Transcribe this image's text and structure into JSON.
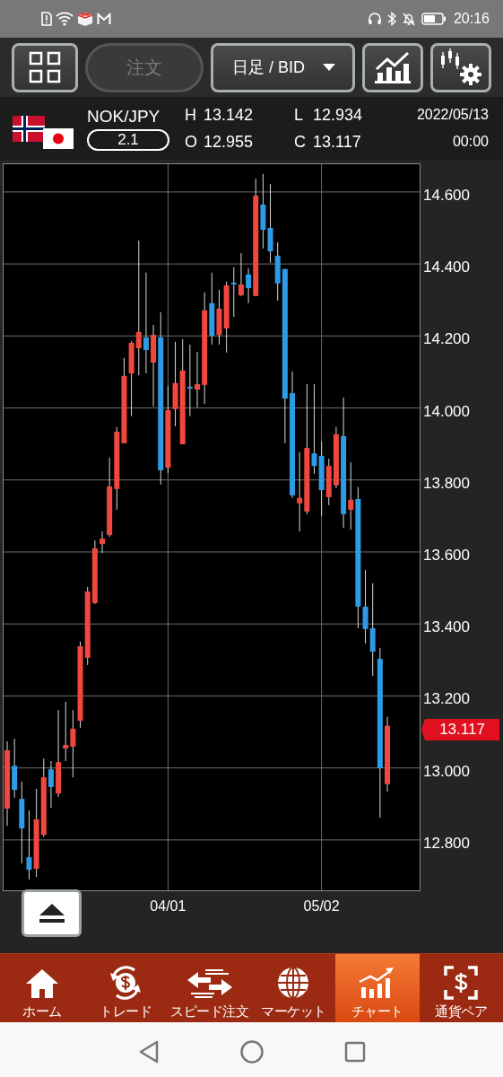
{
  "status_bar": {
    "time": "20:16"
  },
  "toolbar": {
    "order_button": {
      "label": "注文",
      "disabled": true
    },
    "timeframe_dropdown": {
      "label": "日足 / BID"
    }
  },
  "quote": {
    "pair": "NOK/JPY",
    "spread": "2.1",
    "high_label": "H",
    "high": "13.142",
    "low_label": "L",
    "low": "12.934",
    "open_label": "O",
    "open": "12.955",
    "close_label": "C",
    "close": "13.117",
    "date": "2022/05/13",
    "time": "00:00"
  },
  "chart": {
    "current_price": "13.117",
    "chart_data": {
      "type": "candlestick",
      "categories": [
        null,
        null,
        null,
        null,
        null,
        null,
        null,
        null,
        null,
        null,
        null,
        null,
        null,
        null,
        null,
        null,
        null,
        null,
        null,
        null,
        null,
        null,
        "04/01",
        null,
        null,
        null,
        null,
        null,
        null,
        null,
        null,
        null,
        null,
        null,
        null,
        null,
        null,
        null,
        null,
        null,
        null,
        null,
        null,
        "05/02",
        null,
        null,
        null,
        null,
        null,
        null,
        null,
        null,
        null
      ],
      "ohlc": [
        [
          12.887,
          13.074,
          12.839,
          13.049
        ],
        [
          13.006,
          13.081,
          12.917,
          12.939
        ],
        [
          12.914,
          12.962,
          12.735,
          12.832
        ],
        [
          12.752,
          12.882,
          12.69,
          12.717
        ],
        [
          12.72,
          12.942,
          12.697,
          12.857
        ],
        [
          12.814,
          13.026,
          12.809,
          12.974
        ],
        [
          12.996,
          13.019,
          12.889,
          12.947
        ],
        [
          12.929,
          13.161,
          12.919,
          13.016
        ],
        [
          13.054,
          13.184,
          13.019,
          13.064
        ],
        [
          13.059,
          13.161,
          12.974,
          13.109
        ],
        [
          13.131,
          13.351,
          13.111,
          13.338
        ],
        [
          13.306,
          13.503,
          13.286,
          13.49
        ],
        [
          13.458,
          13.632,
          13.455,
          13.61
        ],
        [
          13.622,
          13.657,
          13.597,
          13.637
        ],
        [
          13.647,
          13.862,
          13.642,
          13.782
        ],
        [
          13.775,
          13.947,
          13.717,
          13.934
        ],
        [
          13.902,
          14.139,
          13.902,
          14.089
        ],
        [
          14.096,
          14.186,
          13.977,
          14.181
        ],
        [
          14.166,
          14.465,
          14.091,
          14.211
        ],
        [
          14.196,
          14.376,
          14.096,
          14.161
        ],
        [
          14.126,
          14.231,
          14.004,
          14.203
        ],
        [
          14.196,
          14.266,
          13.787,
          13.827
        ],
        [
          13.834,
          14.061,
          13.819,
          13.994
        ],
        [
          13.997,
          14.184,
          13.949,
          14.069
        ],
        [
          13.899,
          14.191,
          13.899,
          14.104
        ],
        [
          14.059,
          14.176,
          13.977,
          14.054
        ],
        [
          14.051,
          14.156,
          14.001,
          14.066
        ],
        [
          14.064,
          14.321,
          14.011,
          14.271
        ],
        [
          14.291,
          14.376,
          14.176,
          14.201
        ],
        [
          14.203,
          14.328,
          14.176,
          14.276
        ],
        [
          14.221,
          14.351,
          14.154,
          14.341
        ],
        [
          14.348,
          14.391,
          14.253,
          14.343
        ],
        [
          14.313,
          14.43,
          14.311,
          14.343
        ],
        [
          14.371,
          14.388,
          14.291,
          14.333
        ],
        [
          14.311,
          14.637,
          14.311,
          14.59
        ],
        [
          14.565,
          14.65,
          14.443,
          14.495
        ],
        [
          14.5,
          14.622,
          14.403,
          14.435
        ],
        [
          14.423,
          14.46,
          14.298,
          14.346
        ],
        [
          14.386,
          14.386,
          13.902,
          14.026
        ],
        [
          14.041,
          14.101,
          13.75,
          13.757
        ],
        [
          13.735,
          13.877,
          13.657,
          13.75
        ],
        [
          13.712,
          14.066,
          13.705,
          13.889
        ],
        [
          13.874,
          14.066,
          13.817,
          13.839
        ],
        [
          13.867,
          13.907,
          13.7,
          13.772
        ],
        [
          13.752,
          13.859,
          13.73,
          13.839
        ],
        [
          13.785,
          13.947,
          13.777,
          13.927
        ],
        [
          13.922,
          14.029,
          13.667,
          13.705
        ],
        [
          13.717,
          13.849,
          13.662,
          13.745
        ],
        [
          13.747,
          13.78,
          13.388,
          13.448
        ],
        [
          13.448,
          13.55,
          13.346,
          13.386
        ],
        [
          13.388,
          13.513,
          13.256,
          13.323
        ],
        [
          13.303,
          13.333,
          12.862,
          12.999
        ],
        [
          12.955,
          13.142,
          12.934,
          13.117
        ]
      ],
      "ylim": [
        12.66,
        14.677
      ],
      "grid": true,
      "yticks": [
        {
          "value": 14.6,
          "label": "14.600"
        },
        {
          "value": 14.4,
          "label": "14.400"
        },
        {
          "value": 14.2,
          "label": "14.200"
        },
        {
          "value": 14.0,
          "label": "14.000"
        },
        {
          "value": 13.8,
          "label": "13.800"
        },
        {
          "value": 13.6,
          "label": "13.600"
        },
        {
          "value": 13.4,
          "label": "13.400"
        },
        {
          "value": 13.2,
          "label": "13.200"
        },
        {
          "value": 13.0,
          "label": "13.000"
        },
        {
          "value": 12.8,
          "label": "12.800"
        }
      ]
    }
  },
  "bottom_nav": [
    {
      "label": "ホーム",
      "selected": false
    },
    {
      "label": "トレード",
      "selected": false
    },
    {
      "label": "スピード注文",
      "selected": false
    },
    {
      "label": "マーケット",
      "selected": false
    },
    {
      "label": "チャート",
      "selected": true
    },
    {
      "label": "通貨ペア",
      "selected": false
    }
  ]
}
